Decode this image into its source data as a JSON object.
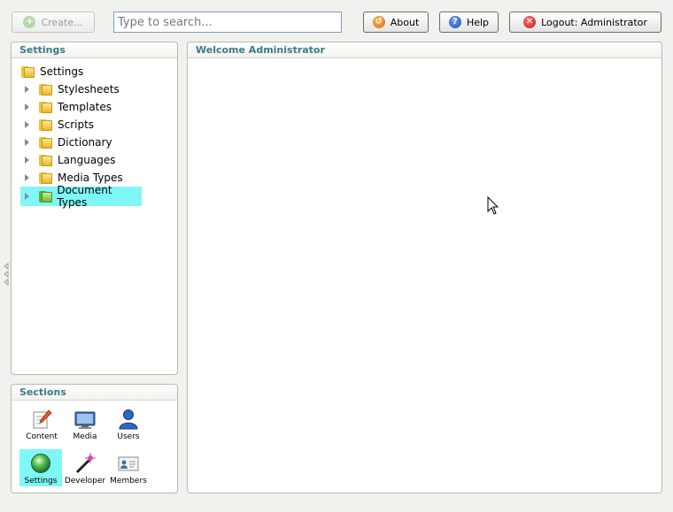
{
  "toolbar": {
    "create_label": "Create...",
    "search_placeholder": "Type to search...",
    "about_label": "About",
    "help_label": "Help",
    "logout_label": "Logout: Administrator"
  },
  "tree": {
    "title": "Settings",
    "root_label": "Settings",
    "items": [
      {
        "label": "Stylesheets"
      },
      {
        "label": "Templates"
      },
      {
        "label": "Scripts"
      },
      {
        "label": "Dictionary"
      },
      {
        "label": "Languages"
      },
      {
        "label": "Media Types"
      },
      {
        "label": "Document Types"
      }
    ],
    "selected_index": 6
  },
  "sections": {
    "title": "Sections",
    "items": [
      {
        "label": "Content",
        "icon": "content-pencil-icon"
      },
      {
        "label": "Media",
        "icon": "media-monitor-icon"
      },
      {
        "label": "Users",
        "icon": "users-person-icon"
      },
      {
        "label": "Settings",
        "icon": "settings-orb-icon"
      },
      {
        "label": "Developer",
        "icon": "developer-wand-icon"
      },
      {
        "label": "Members",
        "icon": "members-card-icon"
      }
    ],
    "active": "Settings"
  },
  "main": {
    "title": "Welcome Administrator"
  },
  "colors": {
    "accent_header": "#3e7a86",
    "selection": "#7ff7f7"
  }
}
